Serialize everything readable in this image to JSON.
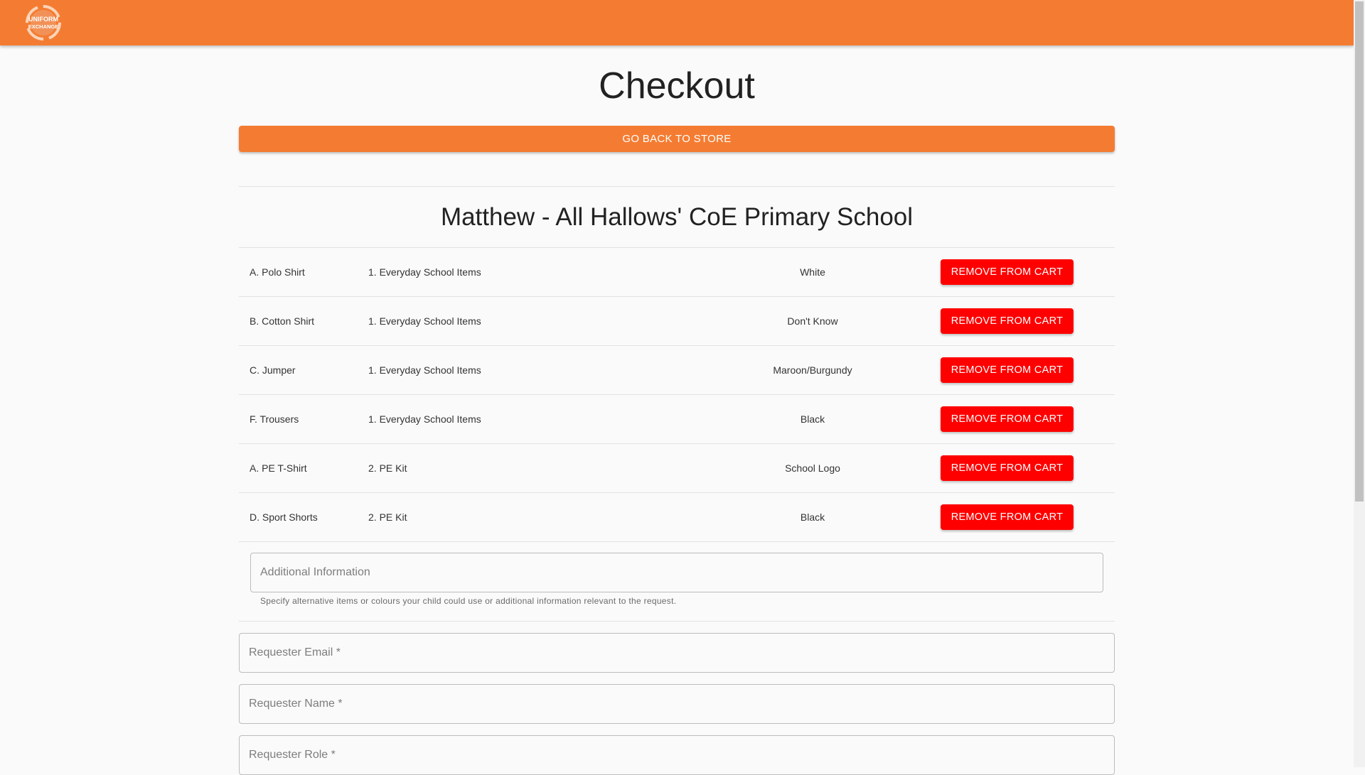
{
  "header": {
    "logo_text_line1": "UNIFORM",
    "logo_text_line2": "EXCHANGE"
  },
  "page": {
    "title": "Checkout",
    "back_button_label": "GO BACK TO STORE"
  },
  "order": {
    "title": "Matthew - All Hallows' CoE Primary School",
    "remove_label": "REMOVE FROM CART",
    "items": [
      {
        "item": "A. Polo Shirt",
        "category": "1. Everyday School Items",
        "colour": "White"
      },
      {
        "item": "B. Cotton Shirt",
        "category": "1. Everyday School Items",
        "colour": "Don't Know"
      },
      {
        "item": "C. Jumper",
        "category": "1. Everyday School Items",
        "colour": "Maroon/Burgundy"
      },
      {
        "item": "F. Trousers",
        "category": "1. Everyday School Items",
        "colour": "Black"
      },
      {
        "item": "A. PE T-Shirt",
        "category": "2. PE Kit",
        "colour": "School Logo"
      },
      {
        "item": "D. Sport Shorts",
        "category": "2. PE Kit",
        "colour": "Black"
      }
    ],
    "additional_info": {
      "placeholder": "Additional Information",
      "helper": "Specify alternative items or colours your child could use or additional information relevant to the request."
    }
  },
  "requester": {
    "email_placeholder": "Requester Email *",
    "name_placeholder": "Requester Name *",
    "role_placeholder": "Requester Role *"
  },
  "colors": {
    "brand_orange": "#f47c32",
    "remove_red": "#ff0000"
  }
}
